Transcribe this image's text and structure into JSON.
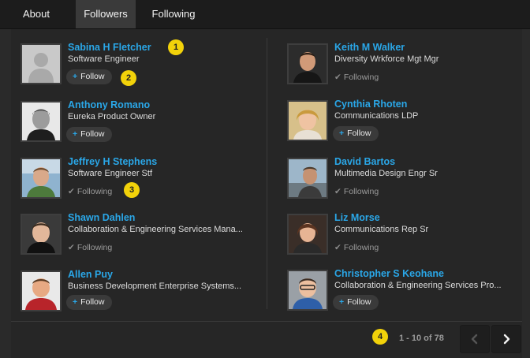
{
  "tabs": [
    {
      "label": "About"
    },
    {
      "label": "Followers"
    },
    {
      "label": "Following"
    }
  ],
  "people": [
    {
      "name": "Sabina H Fletcher",
      "title": "Software Engineer",
      "state": "follow",
      "button_label": "Follow",
      "icon": "placeholder"
    },
    {
      "name": "Keith M Walker",
      "title": "Diversity Wrkforce Mgt Mgr",
      "state": "following",
      "status_label": "Following"
    },
    {
      "name": "Anthony Romano",
      "title": "Eureka Product Owner",
      "state": "follow",
      "button_label": "Follow"
    },
    {
      "name": "Cynthia Rhoten",
      "title": "Communications LDP",
      "state": "follow",
      "button_label": "Follow"
    },
    {
      "name": "Jeffrey H Stephens",
      "title": "Software Engineer Stf",
      "state": "following",
      "status_label": "Following"
    },
    {
      "name": "David Bartos",
      "title": "Multimedia Design Engr Sr",
      "state": "following",
      "status_label": "Following"
    },
    {
      "name": "Shawn Dahlen",
      "title": "Collaboration & Engineering Services Mana...",
      "state": "following",
      "status_label": "Following"
    },
    {
      "name": "Liz Morse",
      "title": "Communications Rep Sr",
      "state": "following",
      "status_label": "Following"
    },
    {
      "name": "Allen Puy",
      "title": "Business Development Enterprise Systems...",
      "state": "follow",
      "button_label": "Follow"
    },
    {
      "name": "Christopher S Keohane",
      "title": "Collaboration & Engineering Services Pro...",
      "state": "follow",
      "button_label": "Follow"
    }
  ],
  "markers": [
    "1",
    "2",
    "3",
    "4"
  ],
  "pagination": {
    "range": "1 - 10 of 78"
  },
  "colors": {
    "accent": "#2aa7e8",
    "marker": "#f2d20a",
    "background": "#2a2a2a"
  }
}
